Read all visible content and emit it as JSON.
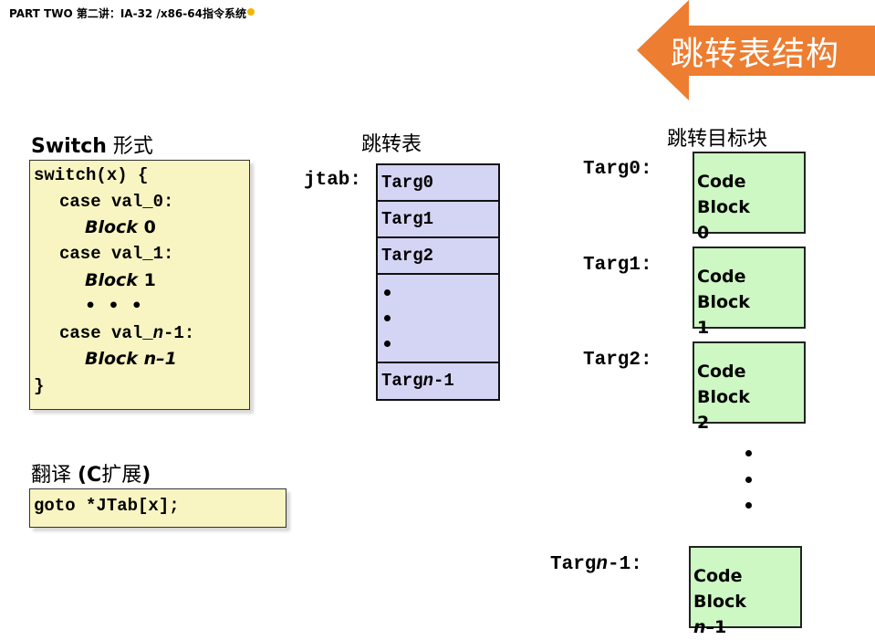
{
  "header": {
    "title": "PART TWO 第二讲：IA-32 /x86-64指令系统"
  },
  "banner": {
    "title": "跳转表结构",
    "color": "#ed7d31"
  },
  "switch_form": {
    "label_bold": "Switch",
    "label_rest": " 形式",
    "lines": {
      "l0": "switch(x) {",
      "l1": "case val_0:",
      "l2_word": "Block",
      "l2_num": " 0",
      "l3": "case val_1:",
      "l4_word": "Block",
      "l4_num": " 1",
      "l5": "•  •  •",
      "l6_a": "case val_",
      "l6_n": "n",
      "l6_b": "-1:",
      "l7_word": "Block",
      "l7_num": " n–1",
      "l8": "}"
    }
  },
  "translation": {
    "label_a": "翻译 ",
    "label_bold": "(C",
    "label_b": "扩展",
    "label_close": ")",
    "code": "goto *JTab[x];"
  },
  "jump_table": {
    "title": "跳转表",
    "label": "jtab:",
    "entries": [
      "Targ0",
      "Targ1",
      "Targ2"
    ],
    "last_entry_a": "Targ",
    "last_entry_n": "n",
    "last_entry_b": "-1"
  },
  "targets": {
    "title": "跳转目标块",
    "items": [
      {
        "label": "Targ0:",
        "block_line1": "Code Block",
        "block_line2": "0"
      },
      {
        "label": "Targ1:",
        "block_line1": "Code Block",
        "block_line2": "1"
      },
      {
        "label": "Targ2:",
        "block_line1": "Code Block",
        "block_line2": "2"
      }
    ],
    "last": {
      "label_a": "Targ",
      "label_n": "n",
      "label_b": "-1:",
      "block_line1": "Code Block",
      "block_line2_n": "n",
      "block_line2_rest": "–1"
    }
  }
}
